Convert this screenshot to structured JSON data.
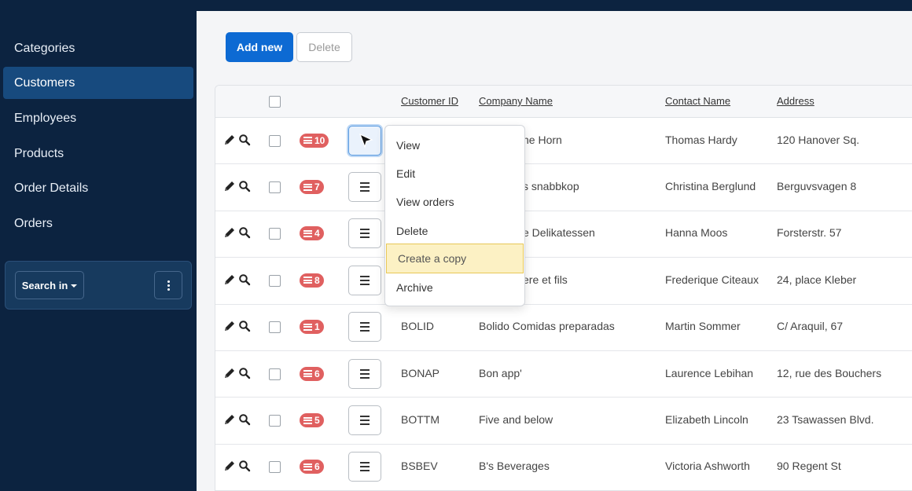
{
  "sidebar": {
    "items": [
      {
        "label": "Categories"
      },
      {
        "label": "Customers"
      },
      {
        "label": "Employees"
      },
      {
        "label": "Products"
      },
      {
        "label": "Order Details"
      },
      {
        "label": "Orders"
      }
    ],
    "active": "Customers",
    "search_in_label": "Search in"
  },
  "toolbar": {
    "add_label": "Add new",
    "delete_label": "Delete"
  },
  "table": {
    "columns": [
      "Customer ID",
      "Company Name",
      "Contact Name",
      "Address"
    ],
    "rows": [
      {
        "badge": "10",
        "id": "",
        "company": "he Horn",
        "contact": "Thomas Hardy",
        "address": "120 Hanover Sq."
      },
      {
        "badge": "7",
        "id": "",
        "company": "s snabbkop",
        "contact": "Christina Berglund",
        "address": "Berguvsvagen 8"
      },
      {
        "badge": "4",
        "id": "",
        "company": "e Delikatessen",
        "contact": "Hanna Moos",
        "address": "Forsterstr. 57"
      },
      {
        "badge": "8",
        "id": "",
        "company": "ere et fils",
        "contact": "Frederique Citeaux",
        "address": "24, place Kleber"
      },
      {
        "badge": "1",
        "id": "BOLID",
        "company": "Bolido Comidas preparadas",
        "contact": "Martin Sommer",
        "address": "C/ Araquil, 67"
      },
      {
        "badge": "6",
        "id": "BONAP",
        "company": "Bon app'",
        "contact": "Laurence Lebihan",
        "address": "12, rue des Bouchers"
      },
      {
        "badge": "5",
        "id": "BOTTM",
        "company": "Five and below",
        "contact": "Elizabeth Lincoln",
        "address": "23 Tsawassen Blvd."
      },
      {
        "badge": "6",
        "id": "BSBEV",
        "company": "B's Beverages",
        "contact": "Victoria Ashworth",
        "address": "90 Regent St"
      }
    ]
  },
  "row_menu": {
    "items": [
      "View",
      "Edit",
      "View orders",
      "Delete",
      "Create a copy",
      "Archive"
    ],
    "highlighted": "Create a copy"
  },
  "colors": {
    "sidebar_bg": "#0c2340",
    "sidebar_active": "#174a7e",
    "primary": "#0d6ad3",
    "badge": "#e06060",
    "menu_highlight": "#fcf1c4"
  }
}
